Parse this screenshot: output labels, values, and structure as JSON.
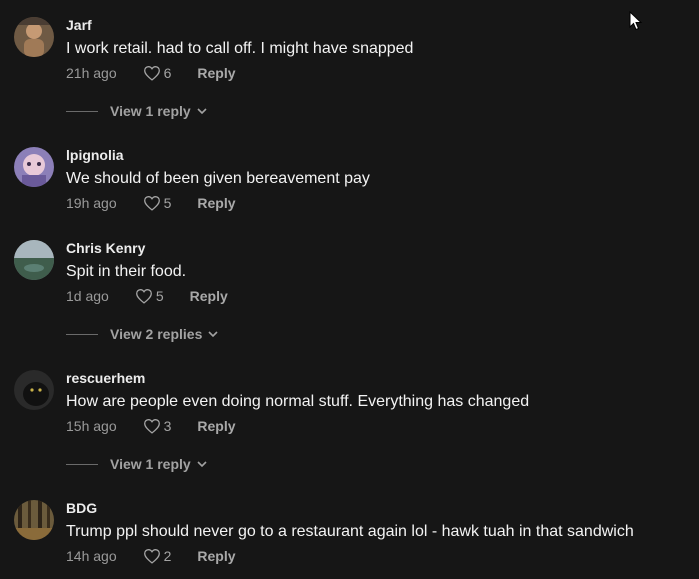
{
  "comments": [
    {
      "username": "Jarf",
      "text": "I work retail. had to call off. I might have snapped",
      "time": "21h ago",
      "likes": "6",
      "reply_label": "Reply",
      "view_replies": "View 1 reply"
    },
    {
      "username": "lpignolia",
      "text": "We should of been given bereavement pay",
      "time": "19h ago",
      "likes": "5",
      "reply_label": "Reply"
    },
    {
      "username": "Chris Kenry",
      "text": "Spit in their food.",
      "time": "1d ago",
      "likes": "5",
      "reply_label": "Reply",
      "view_replies": "View 2 replies"
    },
    {
      "username": "rescuerhem",
      "text": "How are people even doing normal stuff. Everything has changed",
      "time": "15h ago",
      "likes": "3",
      "reply_label": "Reply",
      "view_replies": "View 1 reply"
    },
    {
      "username": "BDG",
      "text": "Trump ppl should never go to a restaurant again lol - hawk tuah in that sandwich",
      "time": "14h ago",
      "likes": "2",
      "reply_label": "Reply"
    }
  ],
  "icons": {
    "like": "heart-outline-icon",
    "expand": "chevron-down-icon",
    "cursor": "mouse-pointer-icon"
  },
  "colors": {
    "background": "#161616",
    "text": "#f3f3f3",
    "muted": "#9a9a9a"
  }
}
